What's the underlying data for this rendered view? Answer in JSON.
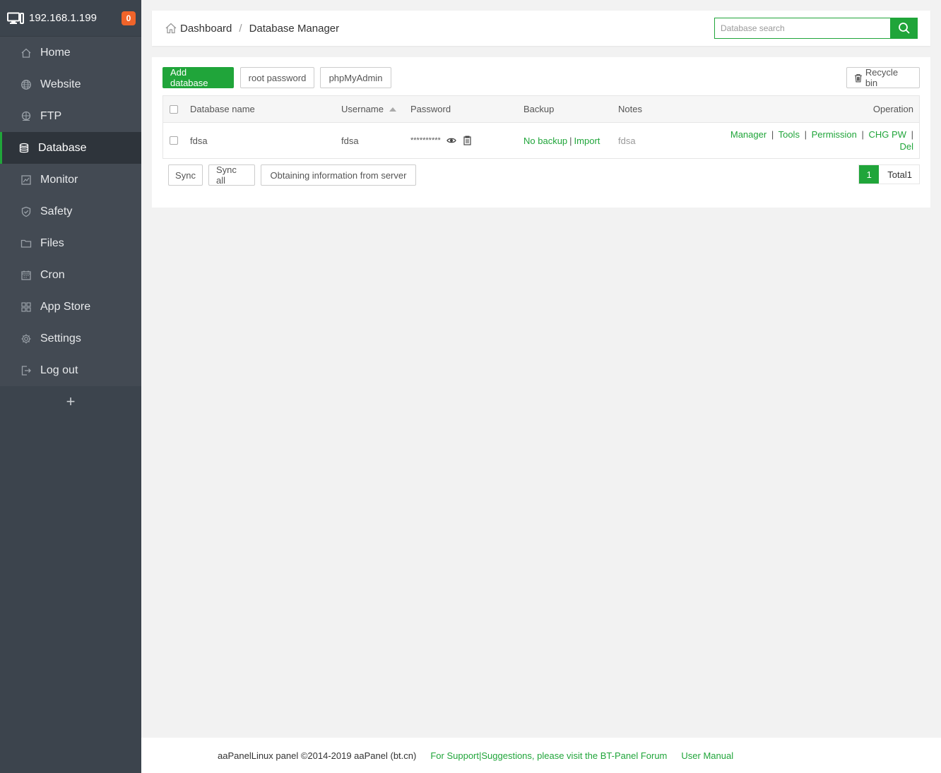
{
  "sidebar": {
    "ip": "192.168.1.199",
    "badge": "0",
    "items": [
      {
        "label": "Home",
        "icon": "home-icon"
      },
      {
        "label": "Website",
        "icon": "globe-icon"
      },
      {
        "label": "FTP",
        "icon": "ftp-icon"
      },
      {
        "label": "Database",
        "icon": "database-icon",
        "active": true
      },
      {
        "label": "Monitor",
        "icon": "monitor-icon"
      },
      {
        "label": "Safety",
        "icon": "shield-icon"
      },
      {
        "label": "Files",
        "icon": "folder-icon"
      },
      {
        "label": "Cron",
        "icon": "calendar-icon"
      },
      {
        "label": "App Store",
        "icon": "apps-grid-icon"
      },
      {
        "label": "Settings",
        "icon": "gear-icon"
      },
      {
        "label": "Log out",
        "icon": "logout-icon"
      }
    ],
    "add_label": "+"
  },
  "header": {
    "breadcrumb_home": "Dashboard",
    "breadcrumb_sep": "/",
    "breadcrumb_current": "Database Manager",
    "search_placeholder": "Database search"
  },
  "toolbar": {
    "add_database": "Add database",
    "root_password": "root password",
    "phpmyadmin": "phpMyAdmin",
    "recycle_bin": "Recycle bin"
  },
  "table": {
    "columns": {
      "name": "Database name",
      "username": "Username",
      "password": "Password",
      "backup": "Backup",
      "notes": "Notes",
      "operation": "Operation"
    },
    "rows": [
      {
        "name": "fdsa",
        "username": "fdsa",
        "password": "**********",
        "backup_none": "No backup",
        "backup_import": "Import",
        "notes": "fdsa",
        "ops": {
          "manager": "Manager",
          "tools": "Tools",
          "permission": "Permission",
          "chg_pw": "CHG PW",
          "del": "Del"
        }
      }
    ],
    "separator": "|"
  },
  "bottom_actions": {
    "sync": "Sync",
    "sync_all": "Sync all",
    "obtain": "Obtaining information from server"
  },
  "pager": {
    "current": "1",
    "total": "Total1"
  },
  "footer": {
    "copyright": "aaPanelLinux panel ©2014-2019 aaPanel (bt.cn)",
    "support": "For Support|Suggestions, please visit the BT-Panel Forum",
    "manual": "User Manual"
  },
  "colors": {
    "accent": "#20a53a",
    "sidebar_bg": "#3c444d",
    "badge": "#f0642a"
  }
}
